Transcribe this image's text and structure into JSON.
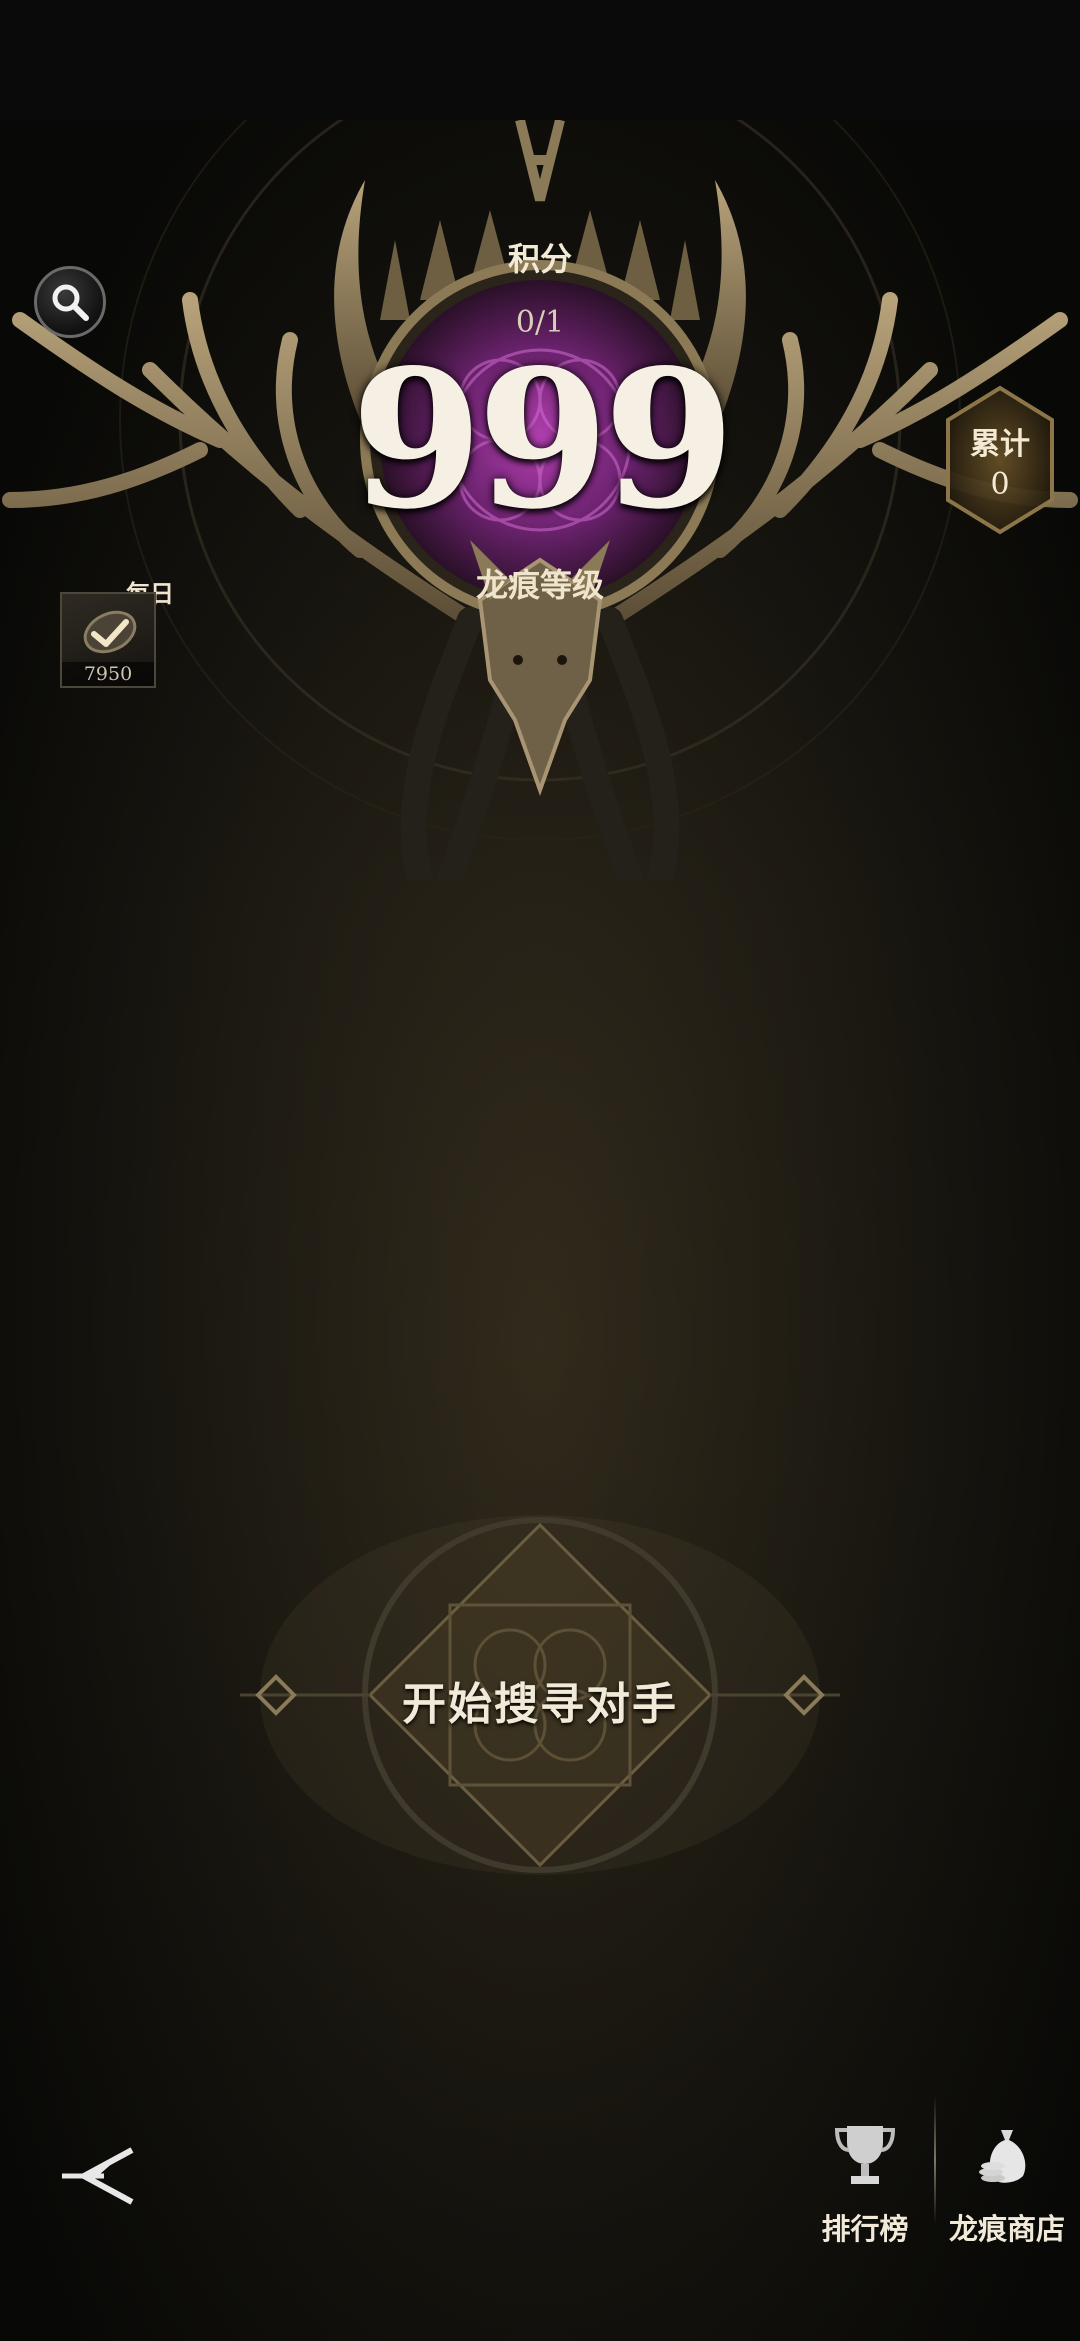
{
  "header": {
    "points_label": "积分",
    "points_value": "0/1",
    "level_number": "999",
    "level_label": "龙痕等级"
  },
  "daily": {
    "label": "每日",
    "count": "7950"
  },
  "cumulative": {
    "label": "累计",
    "value": "0"
  },
  "main": {
    "match_button_label": "开始搜寻对手"
  },
  "bottom_nav": {
    "leaderboard_label": "排行榜",
    "shop_label": "龙痕商店"
  },
  "icons": {
    "search": "search-icon",
    "back": "back-icon",
    "leaderboard": "trophy-icon",
    "shop": "coin-bag-icon",
    "daily": "check-badge-icon"
  },
  "colors": {
    "accent_gold": "#c9a349",
    "emblem_purple": "#8b2d8e",
    "text_light": "#f2ead8"
  }
}
